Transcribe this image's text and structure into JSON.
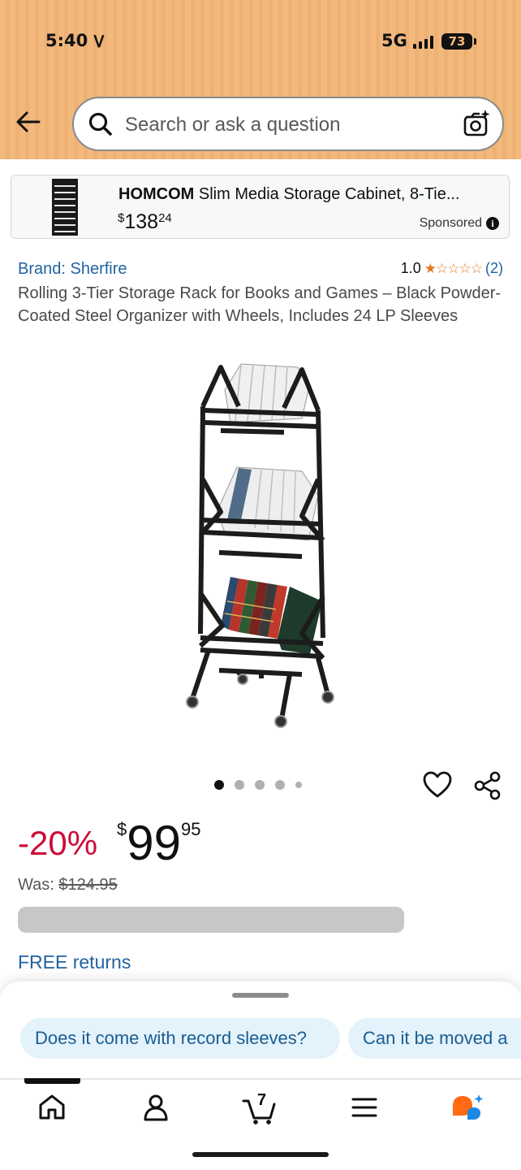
{
  "status_bar": {
    "time": "5:40",
    "network": "5G",
    "battery": "73"
  },
  "header": {
    "search_placeholder": "Search or ask a question"
  },
  "sponsored_ad": {
    "brand": "HOMCOM",
    "title_rest": "Slim Media Storage Cabinet, 8-Tie...",
    "price_symbol": "$",
    "price_whole": "138",
    "price_fraction": "24",
    "sponsored_label": "Sponsored"
  },
  "product": {
    "brand_link": "Brand: Sherfire",
    "rating_value": "1.0",
    "rating_stars": 1,
    "rating_count": "(2)",
    "title": "Rolling 3-Tier Storage Rack for Books and Games – Black Powder-Coated Steel Organizer with Wheels, Includes 24 LP Sleeves",
    "image_count": 5,
    "active_image": 1
  },
  "pricing": {
    "discount": "-20%",
    "currency": "$",
    "price_whole": "99",
    "price_fraction": "95",
    "was_label": "Was:",
    "was_price": "$124.95",
    "returns": "FREE returns"
  },
  "assistant_sheet": {
    "suggestions": [
      "Does it come with record sleeves?",
      "Can it be moved a"
    ]
  },
  "bottom_nav": {
    "items": [
      "home-icon",
      "account-icon",
      "cart-icon",
      "menu-icon",
      "rufus-icon"
    ],
    "cart_count": "7",
    "active": "home"
  },
  "colors": {
    "header_bg": "#f2b97e",
    "link_blue": "#2162a1",
    "discount_red": "#cc0c39",
    "star_orange": "#de7921",
    "chip_bg": "#e3f2fb"
  }
}
